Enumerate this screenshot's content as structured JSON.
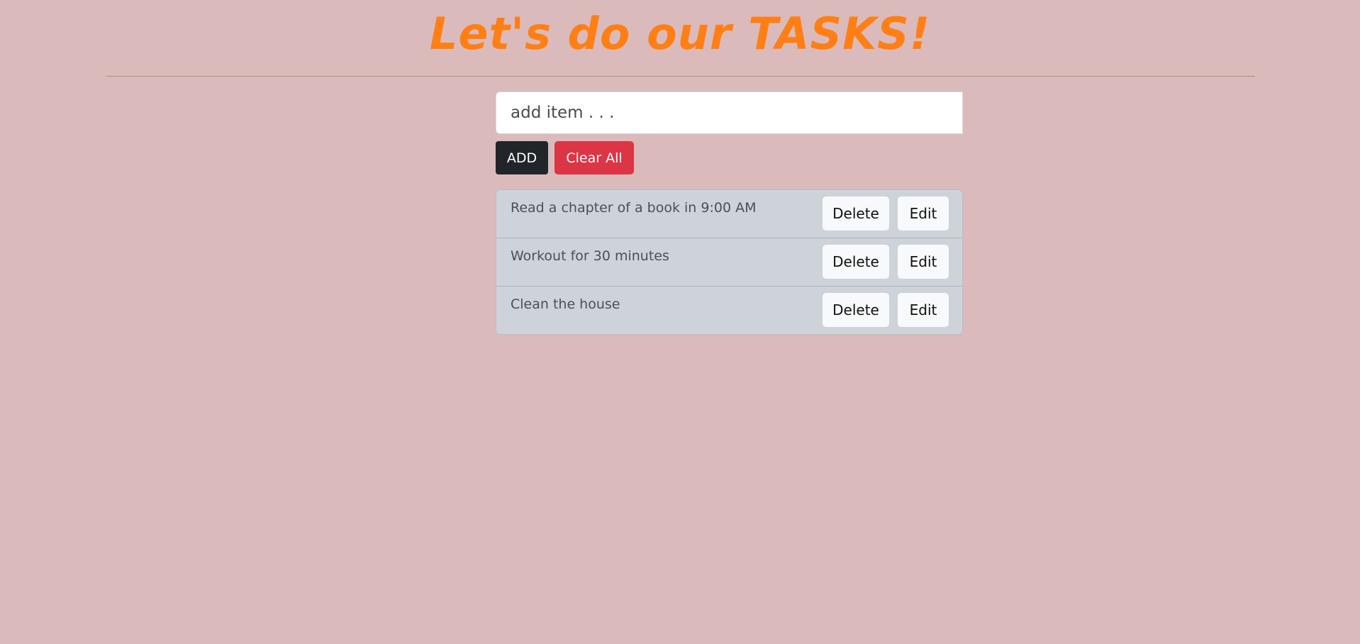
{
  "header": {
    "title": "Let's do our TASKS!"
  },
  "form": {
    "input_placeholder": "add item . . .",
    "input_value": "",
    "add_label": "ADD",
    "clear_label": "Clear All"
  },
  "tasks": [
    {
      "text": "Read a chapter of a book in 9:00 AM",
      "delete_label": "Delete",
      "edit_label": "Edit"
    },
    {
      "text": "Workout for 30 minutes",
      "delete_label": "Delete",
      "edit_label": "Edit"
    },
    {
      "text": "Clean the house",
      "delete_label": "Delete",
      "edit_label": "Edit"
    }
  ],
  "colors": {
    "background": "#dbbabc",
    "title": "#ff7f14",
    "add_button": "#212529",
    "clear_button": "#dc3545",
    "list_background": "#ced3da"
  }
}
